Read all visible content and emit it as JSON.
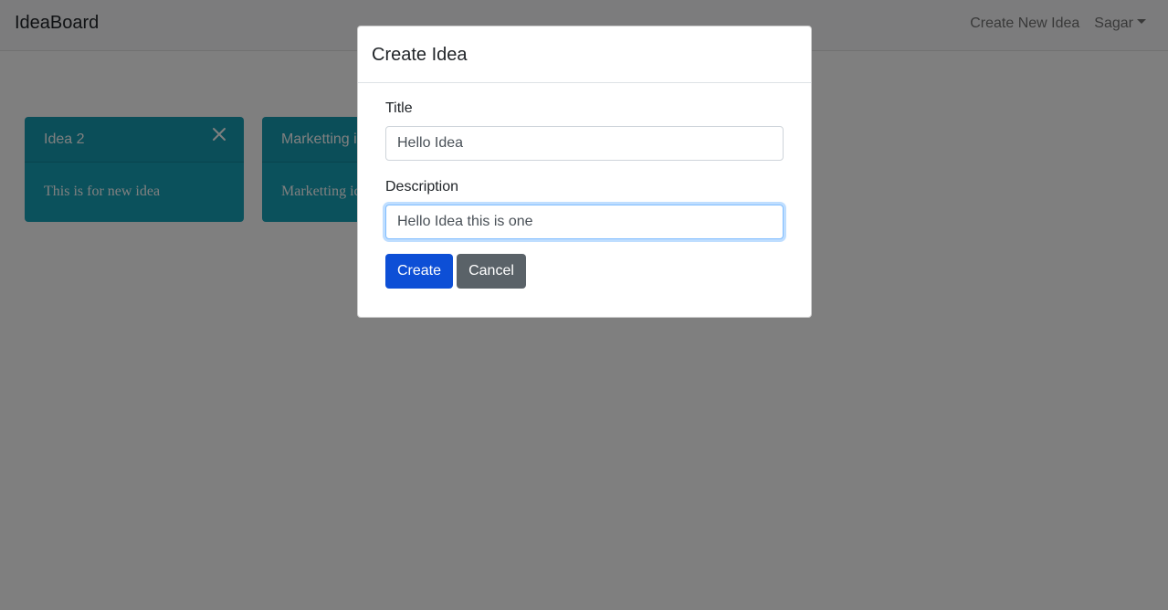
{
  "navbar": {
    "brand": "IdeaBoard",
    "create_link": "Create New Idea",
    "user_menu": "Sagar"
  },
  "cards": [
    {
      "title": "Idea 2",
      "body": "This is for new idea",
      "close_icon": "close-icon"
    },
    {
      "title": "Marketting idea",
      "body": "Marketting idea"
    }
  ],
  "modal": {
    "title": "Create Idea",
    "title_label": "Title",
    "title_value": "Hello Idea",
    "description_label": "Description",
    "description_value": "Hello Idea this is one",
    "create_label": "Create",
    "cancel_label": "Cancel"
  },
  "colors": {
    "card": "#17a2b8",
    "primary": "#0d4fd6",
    "secondary": "#5a6268",
    "focus": "#80bdff"
  }
}
